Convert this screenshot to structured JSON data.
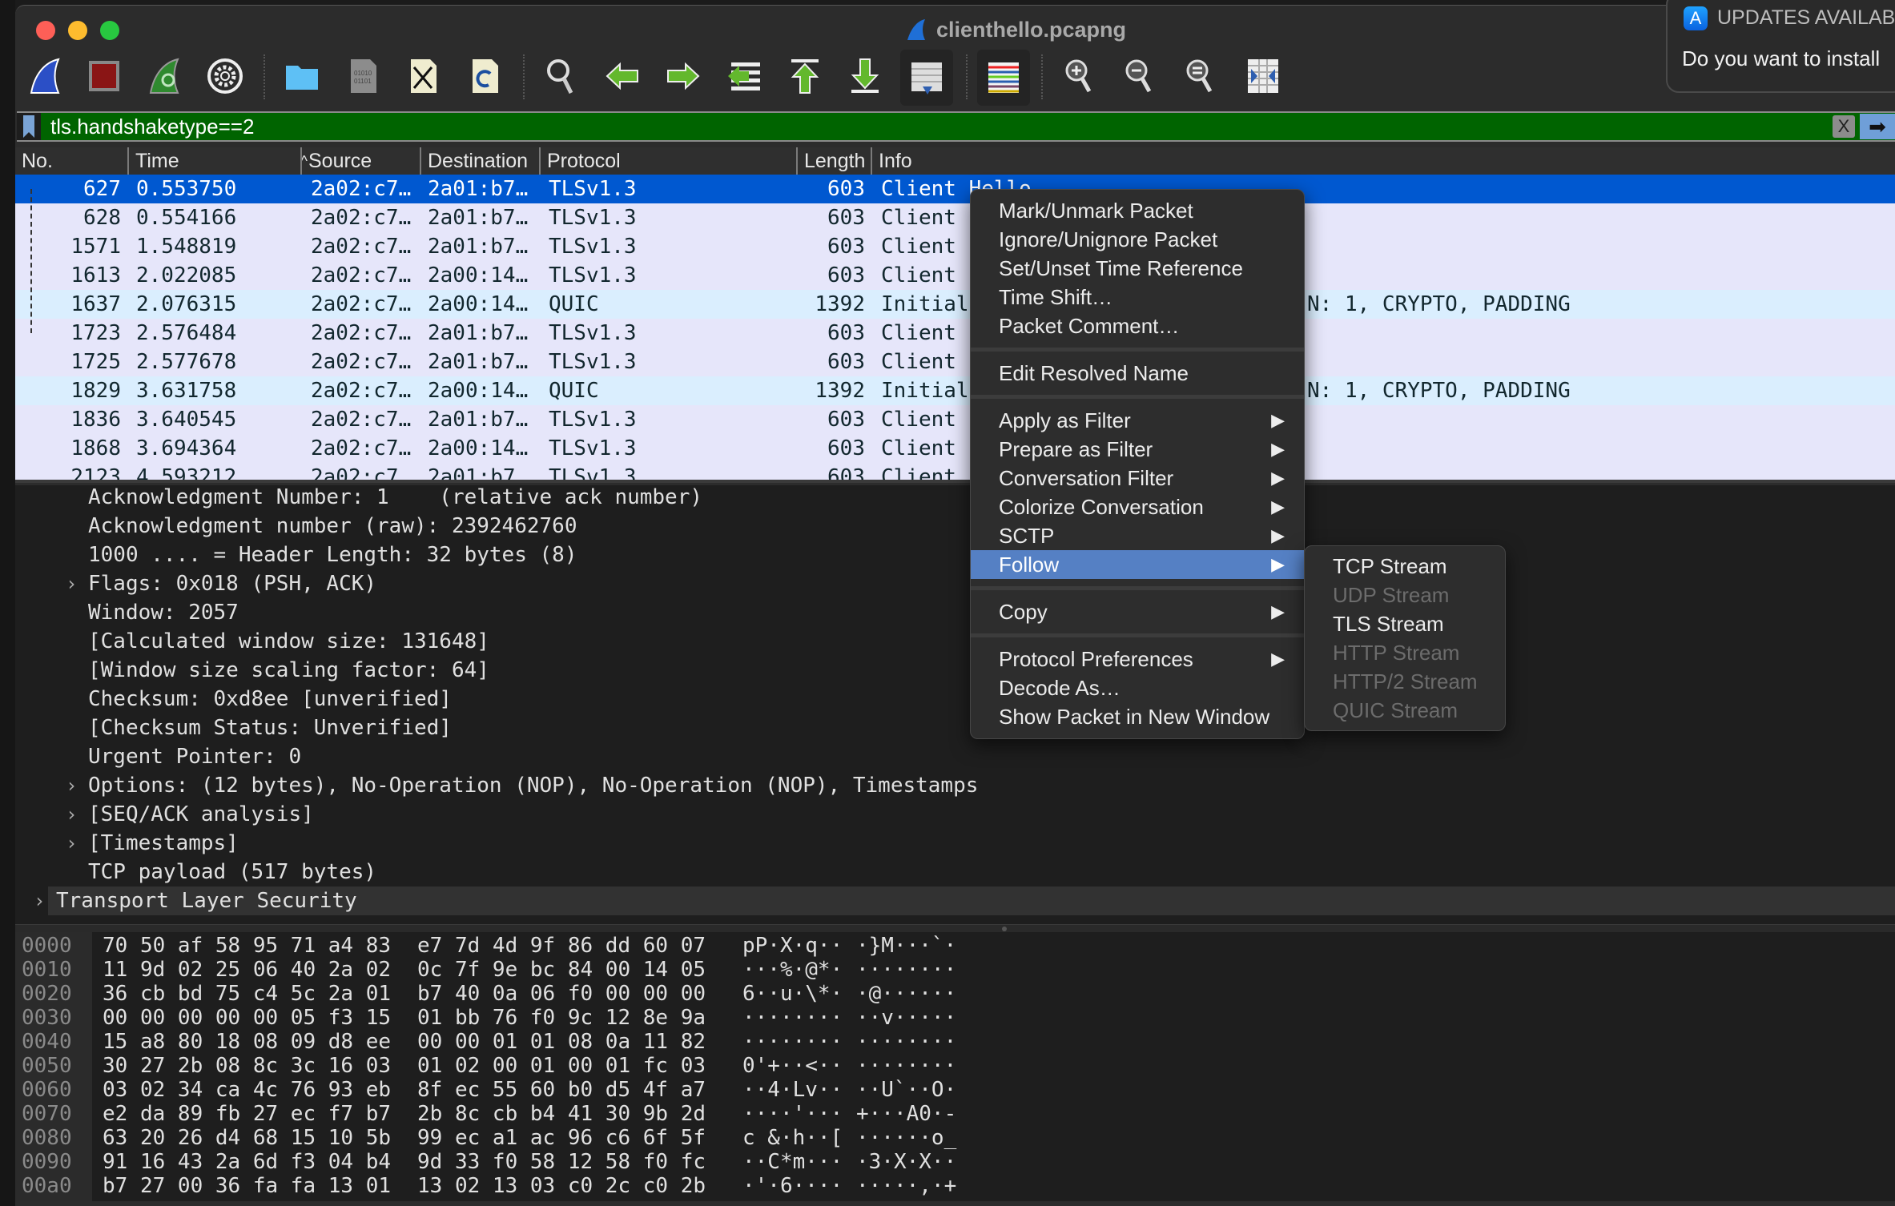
{
  "window": {
    "title": "clienthello.pcapng"
  },
  "toolbar": {
    "icons": [
      "start-capture-icon",
      "stop-capture-icon",
      "restart-capture-icon",
      "capture-options-icon",
      "open-file-icon",
      "save-file-icon",
      "close-file-icon",
      "reload-file-icon",
      "find-packet-icon",
      "go-back-icon",
      "go-forward-icon",
      "go-to-packet-icon",
      "first-packet-icon",
      "last-packet-icon",
      "autoscroll-icon",
      "colorize-icon",
      "zoom-in-icon",
      "zoom-out-icon",
      "normal-size-icon",
      "resize-columns-icon"
    ]
  },
  "filter": {
    "value": "tls.handshaketype==2",
    "clear_label": "X",
    "apply_label": "➡",
    "background": "#006400"
  },
  "columns": [
    "No.",
    "Time",
    "Source",
    "Destination",
    "Protocol",
    "Length",
    "Info"
  ],
  "sort_indicator": "^",
  "packets": [
    {
      "no": "627",
      "time": "0.553750",
      "src": "2a02:c7…",
      "dst": "2a01:b7…",
      "proto": "TLSv1.3",
      "len": "603",
      "info": "Client Hello",
      "selected": true
    },
    {
      "no": "628",
      "time": "0.554166",
      "src": "2a02:c7…",
      "dst": "2a01:b7…",
      "proto": "TLSv1.3",
      "len": "603",
      "info": "Client"
    },
    {
      "no": "1571",
      "time": "1.548819",
      "src": "2a02:c7…",
      "dst": "2a01:b7…",
      "proto": "TLSv1.3",
      "len": "603",
      "info": "Client"
    },
    {
      "no": "1613",
      "time": "2.022085",
      "src": "2a02:c7…",
      "dst": "2a00:14…",
      "proto": "TLSv1.3",
      "len": "603",
      "info": "Client"
    },
    {
      "no": "1637",
      "time": "2.076315",
      "src": "2a02:c7…",
      "dst": "2a00:14…",
      "proto": "QUIC",
      "len": "1392",
      "info": "Initial",
      "info_tail": "N: 1, CRYPTO, PADDING"
    },
    {
      "no": "1723",
      "time": "2.576484",
      "src": "2a02:c7…",
      "dst": "2a01:b7…",
      "proto": "TLSv1.3",
      "len": "603",
      "info": "Client"
    },
    {
      "no": "1725",
      "time": "2.577678",
      "src": "2a02:c7…",
      "dst": "2a01:b7…",
      "proto": "TLSv1.3",
      "len": "603",
      "info": "Client"
    },
    {
      "no": "1829",
      "time": "3.631758",
      "src": "2a02:c7…",
      "dst": "2a00:14…",
      "proto": "QUIC",
      "len": "1392",
      "info": "Initial",
      "info_tail": "N: 1, CRYPTO, PADDING"
    },
    {
      "no": "1836",
      "time": "3.640545",
      "src": "2a02:c7…",
      "dst": "2a01:b7…",
      "proto": "TLSv1.3",
      "len": "603",
      "info": "Client"
    },
    {
      "no": "1868",
      "time": "3.694364",
      "src": "2a02:c7…",
      "dst": "2a00:14…",
      "proto": "TLSv1.3",
      "len": "603",
      "info": "Client"
    },
    {
      "no": "2123",
      "time": "4.593212",
      "src": "2a02:c7…",
      "dst": "2a01:b7…",
      "proto": "TLSv1.3",
      "len": "603",
      "info": "Client"
    }
  ],
  "details": [
    {
      "text": "Acknowledgment Number: 1    (relative ack number)",
      "expandable": false,
      "level": 1
    },
    {
      "text": "Acknowledgment number (raw): 2392462760",
      "expandable": false,
      "level": 1
    },
    {
      "text": "1000 .... = Header Length: 32 bytes (8)",
      "expandable": false,
      "level": 1
    },
    {
      "text": "Flags: 0x018 (PSH, ACK)",
      "expandable": true,
      "level": 1
    },
    {
      "text": "Window: 2057",
      "expandable": false,
      "level": 1
    },
    {
      "text": "[Calculated window size: 131648]",
      "expandable": false,
      "level": 1
    },
    {
      "text": "[Window size scaling factor: 64]",
      "expandable": false,
      "level": 1
    },
    {
      "text": "Checksum: 0xd8ee [unverified]",
      "expandable": false,
      "level": 1
    },
    {
      "text": "[Checksum Status: Unverified]",
      "expandable": false,
      "level": 1
    },
    {
      "text": "Urgent Pointer: 0",
      "expandable": false,
      "level": 1
    },
    {
      "text": "Options: (12 bytes), No-Operation (NOP), No-Operation (NOP), Timestamps",
      "expandable": true,
      "level": 1
    },
    {
      "text": "[SEQ/ACK analysis]",
      "expandable": true,
      "level": 1
    },
    {
      "text": "[Timestamps]",
      "expandable": true,
      "level": 1
    },
    {
      "text": "TCP payload (517 bytes)",
      "expandable": false,
      "level": 1
    },
    {
      "text": "Transport Layer Security",
      "expandable": true,
      "level": 0,
      "highlighted": true
    }
  ],
  "hex": [
    {
      "offset": "0000",
      "h1": "70 50 af 58 95 71 a4 83",
      "h2": "e7 7d 4d 9f 86 dd 60 07",
      "a1": "pP·X·q··",
      "a2": "·}M···`·"
    },
    {
      "offset": "0010",
      "h1": "11 9d 02 25 06 40 2a 02",
      "h2": "0c 7f 9e bc 84 00 14 05",
      "a1": "···%·@*·",
      "a2": "········"
    },
    {
      "offset": "0020",
      "h1": "36 cb bd 75 c4 5c 2a 01",
      "h2": "b7 40 0a 06 f0 00 00 00",
      "a1": "6··u·\\*·",
      "a2": "·@······"
    },
    {
      "offset": "0030",
      "h1": "00 00 00 00 00 05 f3 15",
      "h2": "01 bb 76 f0 9c 12 8e 9a",
      "a1": "········",
      "a2": "··v·····"
    },
    {
      "offset": "0040",
      "h1": "15 a8 80 18 08 09 d8 ee",
      "h2": "00 00 01 01 08 0a 11 82",
      "a1": "········",
      "a2": "········"
    },
    {
      "offset": "0050",
      "h1": "30 27 2b 08 8c 3c 16 03",
      "h2": "01 02 00 01 00 01 fc 03",
      "a1": "0'+··<··",
      "a2": "········"
    },
    {
      "offset": "0060",
      "h1": "03 02 34 ca 4c 76 93 eb",
      "h2": "8f ec 55 60 b0 d5 4f a7",
      "a1": "··4·Lv··",
      "a2": "··U`··O·"
    },
    {
      "offset": "0070",
      "h1": "e2 da 89 fb 27 ec f7 b7",
      "h2": "2b 8c cb b4 41 30 9b 2d",
      "a1": "····'···",
      "a2": "+···A0·-"
    },
    {
      "offset": "0080",
      "h1": "63 20 26 d4 68 15 10 5b",
      "h2": "99 ec a1 ac 96 c6 6f 5f",
      "a1": "c &·h··[",
      "a2": "······o_"
    },
    {
      "offset": "0090",
      "h1": "91 16 43 2a 6d f3 04 b4",
      "h2": "9d 33 f0 58 12 58 f0 fc",
      "a1": "··C*m···",
      "a2": "·3·X·X··"
    },
    {
      "offset": "00a0",
      "h1": "b7 27 00 36 fa fa 13 01",
      "h2": "13 02 13 03 c0 2c c0 2b",
      "a1": "·'·6····",
      "a2": "·····,·+"
    }
  ],
  "context_menu": [
    {
      "label": "Mark/Unmark Packet"
    },
    {
      "label": "Ignore/Unignore Packet"
    },
    {
      "label": "Set/Unset Time Reference"
    },
    {
      "label": "Time Shift…"
    },
    {
      "label": "Packet Comment…"
    },
    {
      "separator": true
    },
    {
      "label": "Edit Resolved Name"
    },
    {
      "separator": true
    },
    {
      "label": "Apply as Filter",
      "submenu": true
    },
    {
      "label": "Prepare as Filter",
      "submenu": true
    },
    {
      "label": "Conversation Filter",
      "submenu": true
    },
    {
      "label": "Colorize Conversation",
      "submenu": true
    },
    {
      "label": "SCTP",
      "submenu": true
    },
    {
      "label": "Follow",
      "submenu": true,
      "highlighted": true
    },
    {
      "separator": true
    },
    {
      "label": "Copy",
      "submenu": true
    },
    {
      "separator": true
    },
    {
      "label": "Protocol Preferences",
      "submenu": true
    },
    {
      "label": "Decode As…"
    },
    {
      "label": "Show Packet in New Window"
    }
  ],
  "follow_submenu": [
    {
      "label": "TCP Stream",
      "enabled": true
    },
    {
      "label": "UDP Stream",
      "enabled": false
    },
    {
      "label": "TLS Stream",
      "enabled": true
    },
    {
      "label": "HTTP Stream",
      "enabled": false
    },
    {
      "label": "HTTP/2 Stream",
      "enabled": false
    },
    {
      "label": "QUIC Stream",
      "enabled": false
    }
  ],
  "notification": {
    "title": "UPDATES AVAILABL",
    "body": "Do you want to install",
    "icon": "app-store-icon"
  },
  "colors": {
    "selected_row": "#0058d0",
    "tls_row": "#e6e6fa",
    "quic_row": "#daeefe",
    "menu_highlight": "#5580c4"
  }
}
